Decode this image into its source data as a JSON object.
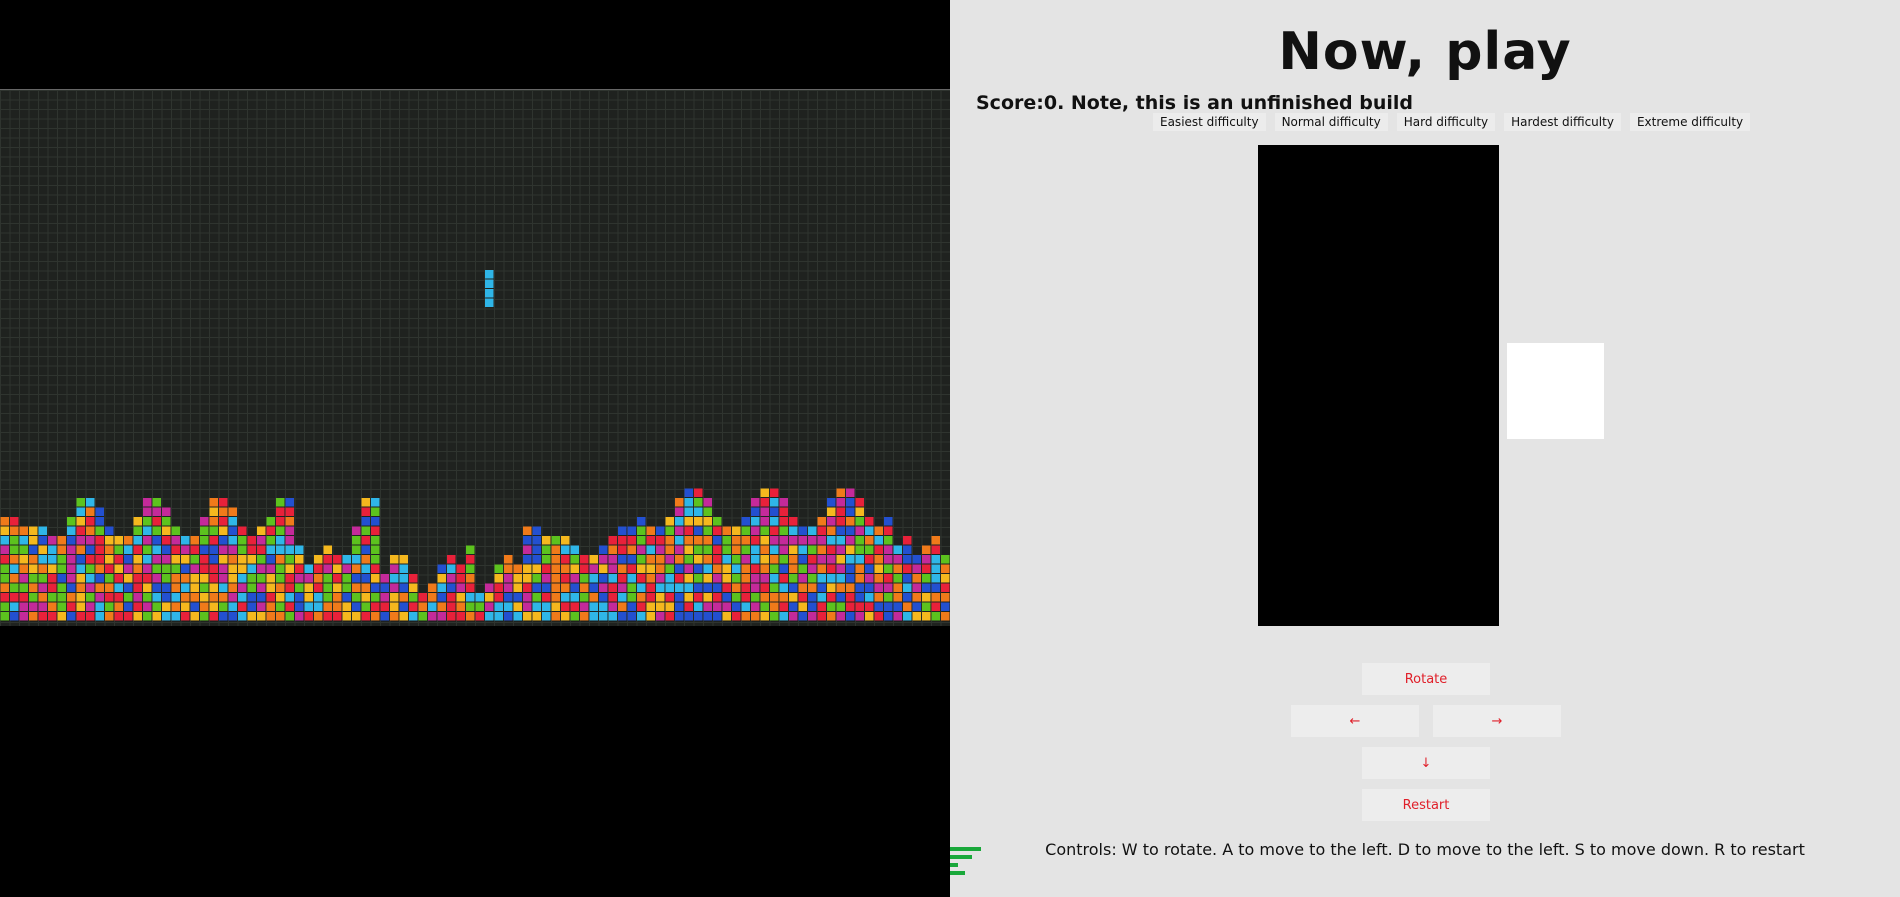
{
  "game": {
    "title": "Now,  play",
    "score_text": "Score:0. Note, this is an unfinished build",
    "difficulties": [
      "Easiest difficulty",
      "Normal difficulty",
      "Hard difficulty",
      "Hardest difficulty",
      "Extreme difficulty"
    ],
    "controls": {
      "rotate": "Rotate",
      "left": "←",
      "right": "→",
      "down": "↓",
      "restart": "Restart"
    },
    "help_text": "Controls: W to rotate. A to move to the left. D to move to the left. S to move down. R to restart"
  },
  "colors": {
    "red": "#e8213a",
    "orange": "#f07a1a",
    "yellow": "#f5b81e",
    "green": "#5cc21e",
    "cyan": "#2fb6e8",
    "blue": "#2350d0",
    "magenta": "#c42a9a",
    "button_text": "#e0202a"
  },
  "icons": {
    "corner": "green-bars-icon"
  }
}
